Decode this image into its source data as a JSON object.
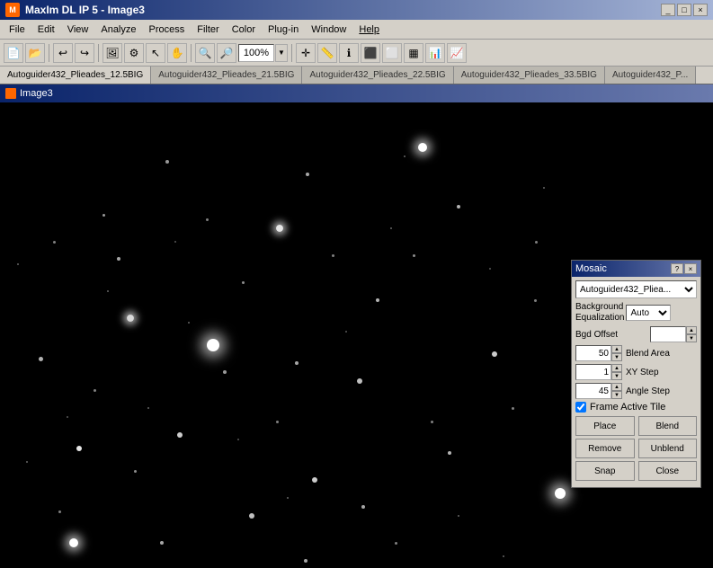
{
  "titleBar": {
    "icon": "M",
    "title": "MaxIm DL IP 5 - Image3",
    "minimizeLabel": "_",
    "maximizeLabel": "□",
    "closeLabel": "×"
  },
  "menuBar": {
    "items": [
      "File",
      "Edit",
      "View",
      "Analyze",
      "Process",
      "Filter",
      "Color",
      "Plug-in",
      "Window",
      "Help"
    ]
  },
  "toolbar": {
    "zoomValue": "100%",
    "zoomDropdownLabel": "▼"
  },
  "tabs": [
    {
      "label": "Autoguider432_Plieades_12.5BIG"
    },
    {
      "label": "Autoguider432_Plieades_21.5BIG"
    },
    {
      "label": "Autoguider432_Plieades_22.5BIG"
    },
    {
      "label": "Autoguider432_Plieades_33.5BIG"
    },
    {
      "label": "Autoguider432_P..."
    }
  ],
  "imageWindow": {
    "icon": "M",
    "title": "Image3"
  },
  "mosaicDialog": {
    "title": "Mosaic",
    "helpLabel": "?",
    "closeLabel": "×",
    "imageDropdown": {
      "value": "Autoguider432_Pliea",
      "options": [
        "Autoguider432_Pliea"
      ]
    },
    "bgdEqualizationLabel": "Background\nEqualization",
    "bgdEqualizationLabel1": "Background",
    "bgdEqualizationLabel2": "Equalization",
    "autoLabel": "Auto",
    "bgdOffsetLabel": "Bgd Offset",
    "blendArea": {
      "value": "50",
      "label": "Blend Area"
    },
    "xyStep": {
      "value": "1",
      "label": "XY Step"
    },
    "angleStep": {
      "value": "45",
      "label": "Angle Step"
    },
    "frameActiveTile": {
      "label": "Frame Active Tile",
      "checked": true
    },
    "buttons": {
      "place": "Place",
      "blend": "Blend",
      "remove": "Remove",
      "unblend": "Unblend",
      "snap": "Snap",
      "close": "Close"
    }
  }
}
